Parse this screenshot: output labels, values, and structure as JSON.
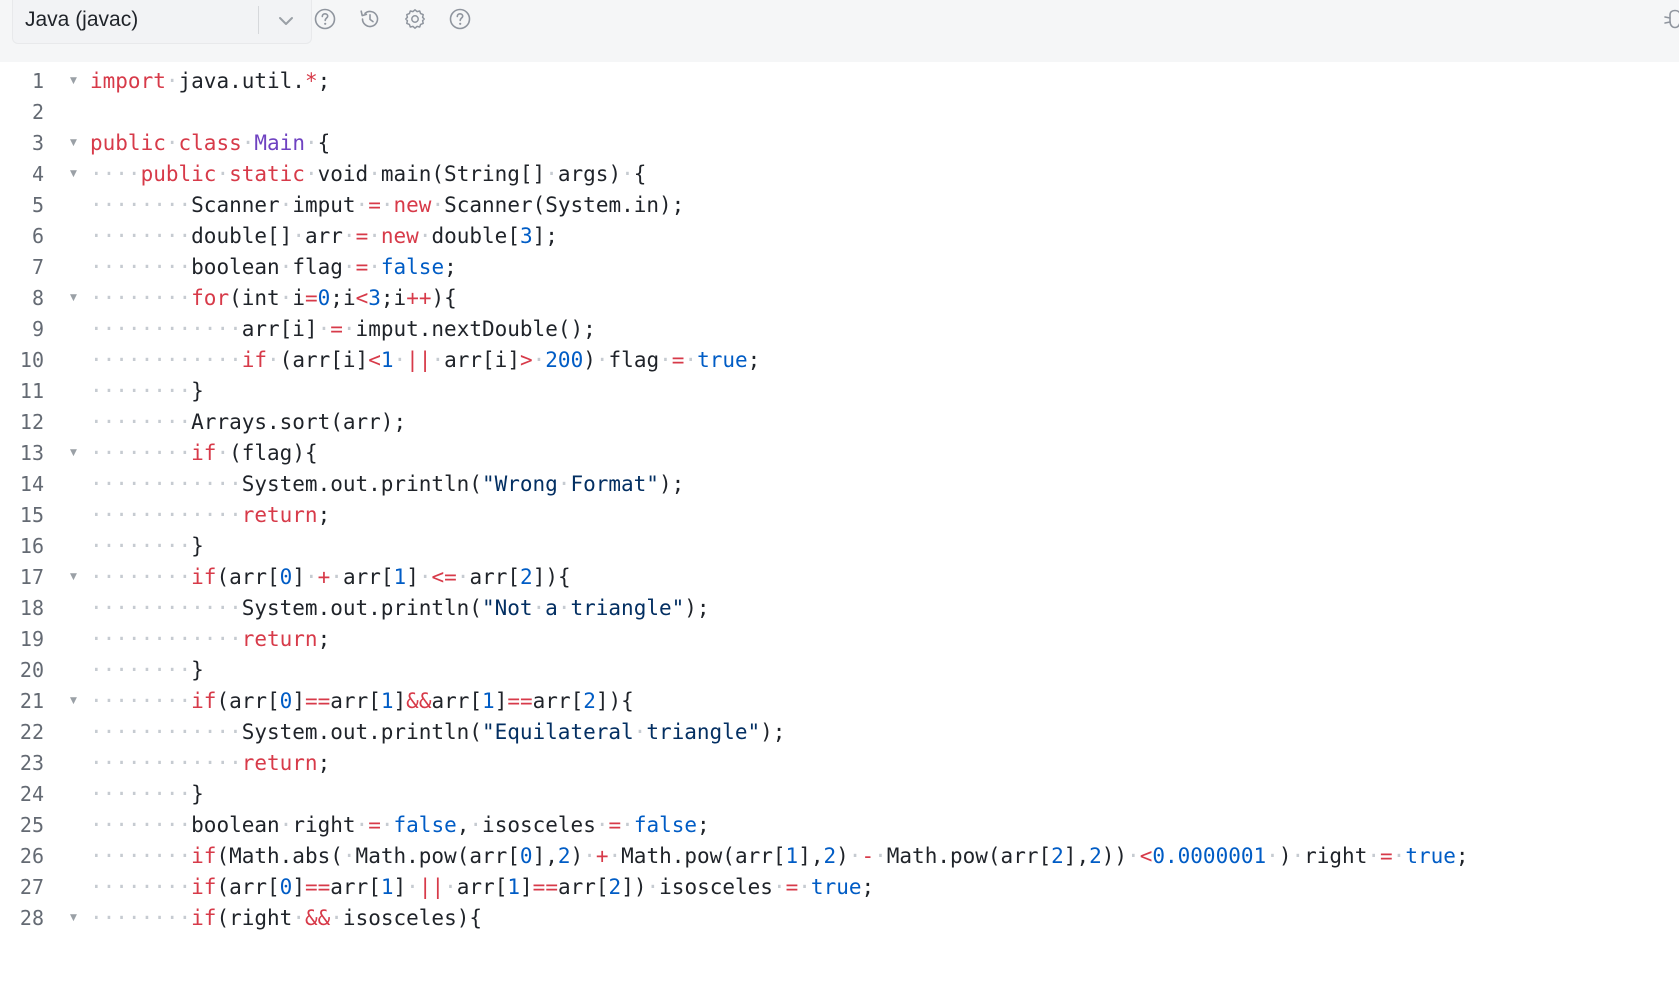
{
  "toolbar": {
    "language": "Java (javac)",
    "icons": [
      "help-circle-icon",
      "history-icon",
      "settings-icon",
      "question-icon"
    ],
    "right_icon": "bug-icon"
  },
  "colors": {
    "keyword": "#d73a49",
    "type": "#6f42c1",
    "number": "#005cc5",
    "string": "#032f62",
    "operator": "#d73a49",
    "whitespace": "#c6cbd1",
    "plain": "#1f2329",
    "line_number": "#646a73"
  },
  "editor": {
    "lines": [
      {
        "n": "1",
        "fold": true,
        "tokens": [
          [
            "kw",
            "import"
          ],
          [
            "ws",
            "·"
          ],
          [
            "pl",
            "java.util."
          ],
          [
            "op",
            "*"
          ],
          [
            "pl",
            ";"
          ]
        ]
      },
      {
        "n": "2",
        "fold": false,
        "tokens": []
      },
      {
        "n": "3",
        "fold": true,
        "tokens": [
          [
            "kw",
            "public"
          ],
          [
            "ws",
            "·"
          ],
          [
            "kw",
            "class"
          ],
          [
            "ws",
            "·"
          ],
          [
            "ty",
            "Main"
          ],
          [
            "ws",
            "·"
          ],
          [
            "pl",
            "{"
          ]
        ]
      },
      {
        "n": "4",
        "fold": true,
        "tokens": [
          [
            "ws",
            "····"
          ],
          [
            "kw",
            "public"
          ],
          [
            "ws",
            "·"
          ],
          [
            "kw",
            "static"
          ],
          [
            "ws",
            "·"
          ],
          [
            "pl",
            "void"
          ],
          [
            "ws",
            "·"
          ],
          [
            "pl",
            "main(String[]"
          ],
          [
            "ws",
            "·"
          ],
          [
            "pl",
            "args)"
          ],
          [
            "ws",
            "·"
          ],
          [
            "pl",
            "{"
          ]
        ]
      },
      {
        "n": "5",
        "fold": false,
        "tokens": [
          [
            "ws",
            "········"
          ],
          [
            "pl",
            "Scanner"
          ],
          [
            "ws",
            "·"
          ],
          [
            "pl",
            "imput"
          ],
          [
            "ws",
            "·"
          ],
          [
            "op",
            "="
          ],
          [
            "ws",
            "·"
          ],
          [
            "kw",
            "new"
          ],
          [
            "ws",
            "·"
          ],
          [
            "pl",
            "Scanner(System.in);"
          ]
        ]
      },
      {
        "n": "6",
        "fold": false,
        "tokens": [
          [
            "ws",
            "········"
          ],
          [
            "pl",
            "double[]"
          ],
          [
            "ws",
            "·"
          ],
          [
            "pl",
            "arr"
          ],
          [
            "ws",
            "·"
          ],
          [
            "op",
            "="
          ],
          [
            "ws",
            "·"
          ],
          [
            "kw",
            "new"
          ],
          [
            "ws",
            "·"
          ],
          [
            "pl",
            "double["
          ],
          [
            "num",
            "3"
          ],
          [
            "pl",
            "];"
          ]
        ]
      },
      {
        "n": "7",
        "fold": false,
        "tokens": [
          [
            "ws",
            "········"
          ],
          [
            "pl",
            "boolean"
          ],
          [
            "ws",
            "·"
          ],
          [
            "pl",
            "flag"
          ],
          [
            "ws",
            "·"
          ],
          [
            "op",
            "="
          ],
          [
            "ws",
            "·"
          ],
          [
            "num",
            "false"
          ],
          [
            "pl",
            ";"
          ]
        ]
      },
      {
        "n": "8",
        "fold": true,
        "tokens": [
          [
            "ws",
            "········"
          ],
          [
            "kw",
            "for"
          ],
          [
            "pl",
            "(int"
          ],
          [
            "ws",
            "·"
          ],
          [
            "pl",
            "i"
          ],
          [
            "op",
            "="
          ],
          [
            "num",
            "0"
          ],
          [
            "pl",
            ";i"
          ],
          [
            "op",
            "<"
          ],
          [
            "num",
            "3"
          ],
          [
            "pl",
            ";i"
          ],
          [
            "op",
            "++"
          ],
          [
            "pl",
            "){"
          ]
        ]
      },
      {
        "n": "9",
        "fold": false,
        "tokens": [
          [
            "ws",
            "············"
          ],
          [
            "pl",
            "arr[i]"
          ],
          [
            "ws",
            "·"
          ],
          [
            "op",
            "="
          ],
          [
            "ws",
            "·"
          ],
          [
            "pl",
            "imput.nextDouble();"
          ]
        ]
      },
      {
        "n": "10",
        "fold": false,
        "tokens": [
          [
            "ws",
            "············"
          ],
          [
            "kw",
            "if"
          ],
          [
            "ws",
            "·"
          ],
          [
            "pl",
            "(arr[i]"
          ],
          [
            "op",
            "<"
          ],
          [
            "num",
            "1"
          ],
          [
            "ws",
            "·"
          ],
          [
            "op",
            "||"
          ],
          [
            "ws",
            "·"
          ],
          [
            "pl",
            "arr[i]"
          ],
          [
            "op",
            ">"
          ],
          [
            "ws",
            "·"
          ],
          [
            "num",
            "200"
          ],
          [
            "pl",
            ")"
          ],
          [
            "ws",
            "·"
          ],
          [
            "pl",
            "flag"
          ],
          [
            "ws",
            "·"
          ],
          [
            "op",
            "="
          ],
          [
            "ws",
            "·"
          ],
          [
            "num",
            "true"
          ],
          [
            "pl",
            ";"
          ]
        ]
      },
      {
        "n": "11",
        "fold": false,
        "tokens": [
          [
            "ws",
            "········"
          ],
          [
            "pl",
            "}"
          ]
        ]
      },
      {
        "n": "12",
        "fold": false,
        "tokens": [
          [
            "ws",
            "········"
          ],
          [
            "pl",
            "Arrays.sort(arr);"
          ]
        ]
      },
      {
        "n": "13",
        "fold": true,
        "tokens": [
          [
            "ws",
            "········"
          ],
          [
            "kw",
            "if"
          ],
          [
            "ws",
            "·"
          ],
          [
            "pl",
            "(flag){"
          ]
        ]
      },
      {
        "n": "14",
        "fold": false,
        "tokens": [
          [
            "ws",
            "············"
          ],
          [
            "pl",
            "System.out.println("
          ],
          [
            "str",
            "\"Wrong"
          ],
          [
            "ws",
            "·"
          ],
          [
            "str",
            "Format\""
          ],
          [
            "pl",
            ");"
          ]
        ]
      },
      {
        "n": "15",
        "fold": false,
        "tokens": [
          [
            "ws",
            "············"
          ],
          [
            "kw",
            "return"
          ],
          [
            "pl",
            ";"
          ]
        ]
      },
      {
        "n": "16",
        "fold": false,
        "tokens": [
          [
            "ws",
            "········"
          ],
          [
            "pl",
            "}"
          ]
        ]
      },
      {
        "n": "17",
        "fold": true,
        "tokens": [
          [
            "ws",
            "········"
          ],
          [
            "kw",
            "if"
          ],
          [
            "pl",
            "(arr["
          ],
          [
            "num",
            "0"
          ],
          [
            "pl",
            "]"
          ],
          [
            "ws",
            "·"
          ],
          [
            "op",
            "+"
          ],
          [
            "ws",
            "·"
          ],
          [
            "pl",
            "arr["
          ],
          [
            "num",
            "1"
          ],
          [
            "pl",
            "]"
          ],
          [
            "ws",
            "·"
          ],
          [
            "op",
            "<="
          ],
          [
            "ws",
            "·"
          ],
          [
            "pl",
            "arr["
          ],
          [
            "num",
            "2"
          ],
          [
            "pl",
            "]){"
          ]
        ]
      },
      {
        "n": "18",
        "fold": false,
        "tokens": [
          [
            "ws",
            "············"
          ],
          [
            "pl",
            "System.out.println("
          ],
          [
            "str",
            "\"Not"
          ],
          [
            "ws",
            "·"
          ],
          [
            "str",
            "a"
          ],
          [
            "ws",
            "·"
          ],
          [
            "str",
            "triangle\""
          ],
          [
            "pl",
            ");"
          ]
        ]
      },
      {
        "n": "19",
        "fold": false,
        "tokens": [
          [
            "ws",
            "············"
          ],
          [
            "kw",
            "return"
          ],
          [
            "pl",
            ";"
          ]
        ]
      },
      {
        "n": "20",
        "fold": false,
        "tokens": [
          [
            "ws",
            "········"
          ],
          [
            "pl",
            "}"
          ]
        ]
      },
      {
        "n": "21",
        "fold": true,
        "tokens": [
          [
            "ws",
            "········"
          ],
          [
            "kw",
            "if"
          ],
          [
            "pl",
            "(arr["
          ],
          [
            "num",
            "0"
          ],
          [
            "pl",
            "]"
          ],
          [
            "op",
            "=="
          ],
          [
            "pl",
            "arr["
          ],
          [
            "num",
            "1"
          ],
          [
            "pl",
            "]"
          ],
          [
            "op",
            "&&"
          ],
          [
            "pl",
            "arr["
          ],
          [
            "num",
            "1"
          ],
          [
            "pl",
            "]"
          ],
          [
            "op",
            "=="
          ],
          [
            "pl",
            "arr["
          ],
          [
            "num",
            "2"
          ],
          [
            "pl",
            "]){"
          ]
        ]
      },
      {
        "n": "22",
        "fold": false,
        "tokens": [
          [
            "ws",
            "············"
          ],
          [
            "pl",
            "System.out.println("
          ],
          [
            "str",
            "\"Equilateral"
          ],
          [
            "ws",
            "·"
          ],
          [
            "str",
            "triangle\""
          ],
          [
            "pl",
            ");"
          ]
        ]
      },
      {
        "n": "23",
        "fold": false,
        "tokens": [
          [
            "ws",
            "············"
          ],
          [
            "kw",
            "return"
          ],
          [
            "pl",
            ";"
          ]
        ]
      },
      {
        "n": "24",
        "fold": false,
        "tokens": [
          [
            "ws",
            "········"
          ],
          [
            "pl",
            "}"
          ]
        ]
      },
      {
        "n": "25",
        "fold": false,
        "tokens": [
          [
            "ws",
            "········"
          ],
          [
            "pl",
            "boolean"
          ],
          [
            "ws",
            "·"
          ],
          [
            "pl",
            "right"
          ],
          [
            "ws",
            "·"
          ],
          [
            "op",
            "="
          ],
          [
            "ws",
            "·"
          ],
          [
            "num",
            "false"
          ],
          [
            "pl",
            ","
          ],
          [
            "ws",
            "·"
          ],
          [
            "pl",
            "isosceles"
          ],
          [
            "ws",
            "·"
          ],
          [
            "op",
            "="
          ],
          [
            "ws",
            "·"
          ],
          [
            "num",
            "false"
          ],
          [
            "pl",
            ";"
          ]
        ]
      },
      {
        "n": "26",
        "fold": false,
        "tokens": [
          [
            "ws",
            "········"
          ],
          [
            "kw",
            "if"
          ],
          [
            "pl",
            "(Math.abs("
          ],
          [
            "ws",
            "·"
          ],
          [
            "pl",
            "Math.pow(arr["
          ],
          [
            "num",
            "0"
          ],
          [
            "pl",
            "],"
          ],
          [
            "num",
            "2"
          ],
          [
            "pl",
            ")"
          ],
          [
            "ws",
            "·"
          ],
          [
            "op",
            "+"
          ],
          [
            "ws",
            "·"
          ],
          [
            "pl",
            "Math.pow(arr["
          ],
          [
            "num",
            "1"
          ],
          [
            "pl",
            "],"
          ],
          [
            "num",
            "2"
          ],
          [
            "pl",
            ")"
          ],
          [
            "ws",
            "·"
          ],
          [
            "op",
            "-"
          ],
          [
            "ws",
            "·"
          ],
          [
            "pl",
            "Math.pow(arr["
          ],
          [
            "num",
            "2"
          ],
          [
            "pl",
            "],"
          ],
          [
            "num",
            "2"
          ],
          [
            "pl",
            "))"
          ],
          [
            "ws",
            "·"
          ],
          [
            "op",
            "<"
          ],
          [
            "num",
            "0.0000001"
          ],
          [
            "ws",
            "·"
          ],
          [
            "pl",
            ")"
          ],
          [
            "ws",
            "·"
          ],
          [
            "pl",
            "right"
          ],
          [
            "ws",
            "·"
          ],
          [
            "op",
            "="
          ],
          [
            "ws",
            "·"
          ],
          [
            "num",
            "true"
          ],
          [
            "pl",
            ";"
          ]
        ]
      },
      {
        "n": "27",
        "fold": false,
        "tokens": [
          [
            "ws",
            "········"
          ],
          [
            "kw",
            "if"
          ],
          [
            "pl",
            "(arr["
          ],
          [
            "num",
            "0"
          ],
          [
            "pl",
            "]"
          ],
          [
            "op",
            "=="
          ],
          [
            "pl",
            "arr["
          ],
          [
            "num",
            "1"
          ],
          [
            "pl",
            "]"
          ],
          [
            "ws",
            "·"
          ],
          [
            "op",
            "||"
          ],
          [
            "ws",
            "·"
          ],
          [
            "pl",
            "arr["
          ],
          [
            "num",
            "1"
          ],
          [
            "pl",
            "]"
          ],
          [
            "op",
            "=="
          ],
          [
            "pl",
            "arr["
          ],
          [
            "num",
            "2"
          ],
          [
            "pl",
            "])"
          ],
          [
            "ws",
            "·"
          ],
          [
            "pl",
            "isosceles"
          ],
          [
            "ws",
            "·"
          ],
          [
            "op",
            "="
          ],
          [
            "ws",
            "·"
          ],
          [
            "num",
            "true"
          ],
          [
            "pl",
            ";"
          ]
        ]
      },
      {
        "n": "28",
        "fold": true,
        "tokens": [
          [
            "ws",
            "········"
          ],
          [
            "kw",
            "if"
          ],
          [
            "pl",
            "(right"
          ],
          [
            "ws",
            "·"
          ],
          [
            "op",
            "&&"
          ],
          [
            "ws",
            "·"
          ],
          [
            "pl",
            "isosceles){"
          ]
        ]
      }
    ]
  }
}
